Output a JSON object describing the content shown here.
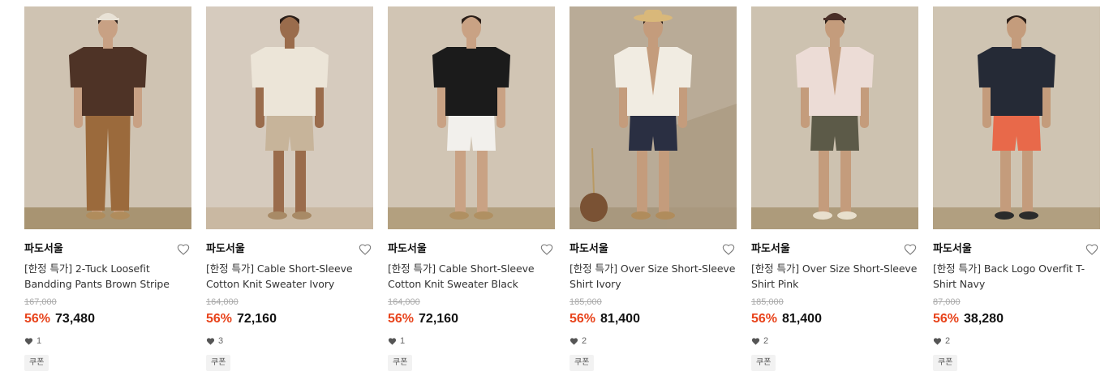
{
  "products": [
    {
      "brand": "파도서울",
      "title": "[한정 특가] 2-Tuck Loosefit Bandding Pants Brown Stripe",
      "original_price": "167,000",
      "discount": "56%",
      "price": "73,480",
      "likes": "1",
      "coupon": "쿠폰",
      "colors": {
        "bg": "#cfc3b2",
        "floor": "#a89472",
        "top": "#4e3326",
        "bottom": "#9b6a3c",
        "skin": "#c8a184",
        "hat": "#e9e2d6",
        "shoe": "#b08c5c"
      }
    },
    {
      "brand": "파도서울",
      "title": "[한정 특가] Cable Short-Sleeve Cotton Knit Sweater Ivory",
      "original_price": "164,000",
      "discount": "56%",
      "price": "72,160",
      "likes": "3",
      "coupon": "쿠폰",
      "colors": {
        "bg": "#d6cbbe",
        "floor": "#c9b8a2",
        "top": "#ece5d8",
        "bottom": "#c7b49a",
        "skin": "#9a6c4c",
        "hat": "",
        "shoe": "#a88a66"
      }
    },
    {
      "brand": "파도서울",
      "title": "[한정 특가] Cable Short-Sleeve Cotton Knit Sweater Black",
      "original_price": "164,000",
      "discount": "56%",
      "price": "72,160",
      "likes": "1",
      "coupon": "쿠폰",
      "colors": {
        "bg": "#d1c5b4",
        "floor": "#b3a07f",
        "top": "#1b1b1b",
        "bottom": "#f2f0ec",
        "skin": "#c9a284",
        "hat": "",
        "shoe": "#b09062"
      }
    },
    {
      "brand": "파도서울",
      "title": "[한정 특가] Over Size Short-Sleeve Shirt Ivory",
      "original_price": "185,000",
      "discount": "56%",
      "price": "81,400",
      "likes": "2",
      "coupon": "쿠폰",
      "colors": {
        "bg": "#b9ab97",
        "floor": "#a8987e",
        "top": "#f1ece2",
        "bottom": "#2a2f42",
        "skin": "#c49c7c",
        "hat": "#d9b87a",
        "shoe": "#b08c5c"
      }
    },
    {
      "brand": "파도서울",
      "title": "[한정 특가] Over Size Short-Sleeve Shirt Pink",
      "original_price": "185,000",
      "discount": "56%",
      "price": "81,400",
      "likes": "2",
      "coupon": "쿠폰",
      "colors": {
        "bg": "#cdc2b0",
        "floor": "#ad9b7b",
        "top": "#ecdcd6",
        "bottom": "#5c5a48",
        "skin": "#c49c7c",
        "hat": "#4a2f28",
        "shoe": "#e8dfcd"
      }
    },
    {
      "brand": "파도서울",
      "title": "[한정 특가] Back Logo Overfit T-Shirt Navy",
      "original_price": "87,000",
      "discount": "56%",
      "price": "38,280",
      "likes": "2",
      "coupon": "쿠폰",
      "colors": {
        "bg": "#cfc4b2",
        "floor": "#b19f80",
        "top": "#252a36",
        "bottom": "#e8694a",
        "skin": "#c49c7c",
        "hat": "",
        "shoe": "#2b2b2b"
      }
    }
  ]
}
